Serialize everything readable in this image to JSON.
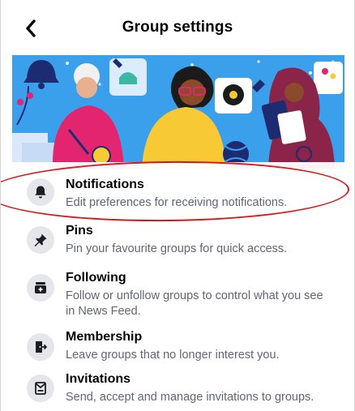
{
  "header": {
    "title": "Group settings",
    "back_icon": "chevron-left-icon"
  },
  "banner": {
    "description_colors": {
      "sky": "#3aa0ec",
      "pink": "#e2256e",
      "yellow": "#f7c934",
      "purple": "#8a2448",
      "navy": "#1d2c72"
    }
  },
  "settings": [
    {
      "title": "Notifications",
      "description": "Edit preferences for receiving notifications.",
      "icon": "bell-icon"
    },
    {
      "title": "Pins",
      "description": "Pin your favourite groups for quick access.",
      "icon": "pin-icon"
    },
    {
      "title": "Following",
      "description": "Follow or unfollow groups to control what you see in News Feed.",
      "icon": "feed-icon"
    },
    {
      "title": "Membership",
      "description": "Leave groups that no longer interest you.",
      "icon": "exit-door-icon"
    },
    {
      "title": "Invitations",
      "description": "Send, accept and manage invitations to groups.",
      "icon": "invitation-icon"
    }
  ],
  "annotation": {
    "color": "#d8181c",
    "highlighted_item": "Notifications"
  }
}
